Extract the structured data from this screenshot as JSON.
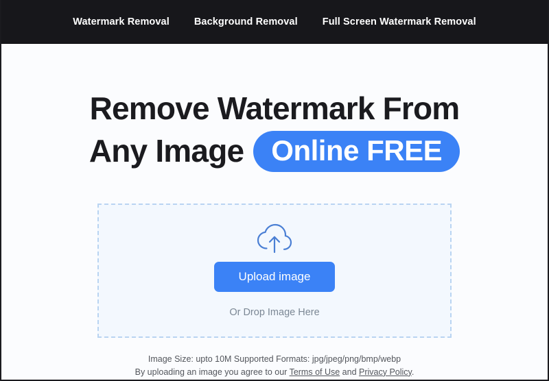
{
  "nav": {
    "items": [
      {
        "label": "Watermark Removal"
      },
      {
        "label": "Background Removal"
      },
      {
        "label": "Full Screen Watermark Removal"
      }
    ]
  },
  "hero": {
    "line1": "Remove Watermark From",
    "line2_plain": "Any Image",
    "line2_highlight": "Online FREE"
  },
  "dropzone": {
    "icon": "cloud-upload-icon",
    "upload_button_label": "Upload image",
    "drop_hint": "Or Drop Image Here"
  },
  "footnotes": {
    "line1": "Image Size: upto 10M Supported Formats: jpg/jpeg/png/bmp/webp",
    "line2_prefix": "By uploading an image you agree to our ",
    "terms_link": "Terms of Use",
    "line2_middle": " and ",
    "privacy_link": "Privacy Policy",
    "line2_suffix": "."
  },
  "colors": {
    "nav_background": "#17171b",
    "accent_blue": "#3b82f6",
    "dropzone_border": "#b9d4f2",
    "dropzone_background": "#f3f8fe",
    "page_background": "#fbfcfe",
    "heading_text": "#1b1b1f"
  }
}
